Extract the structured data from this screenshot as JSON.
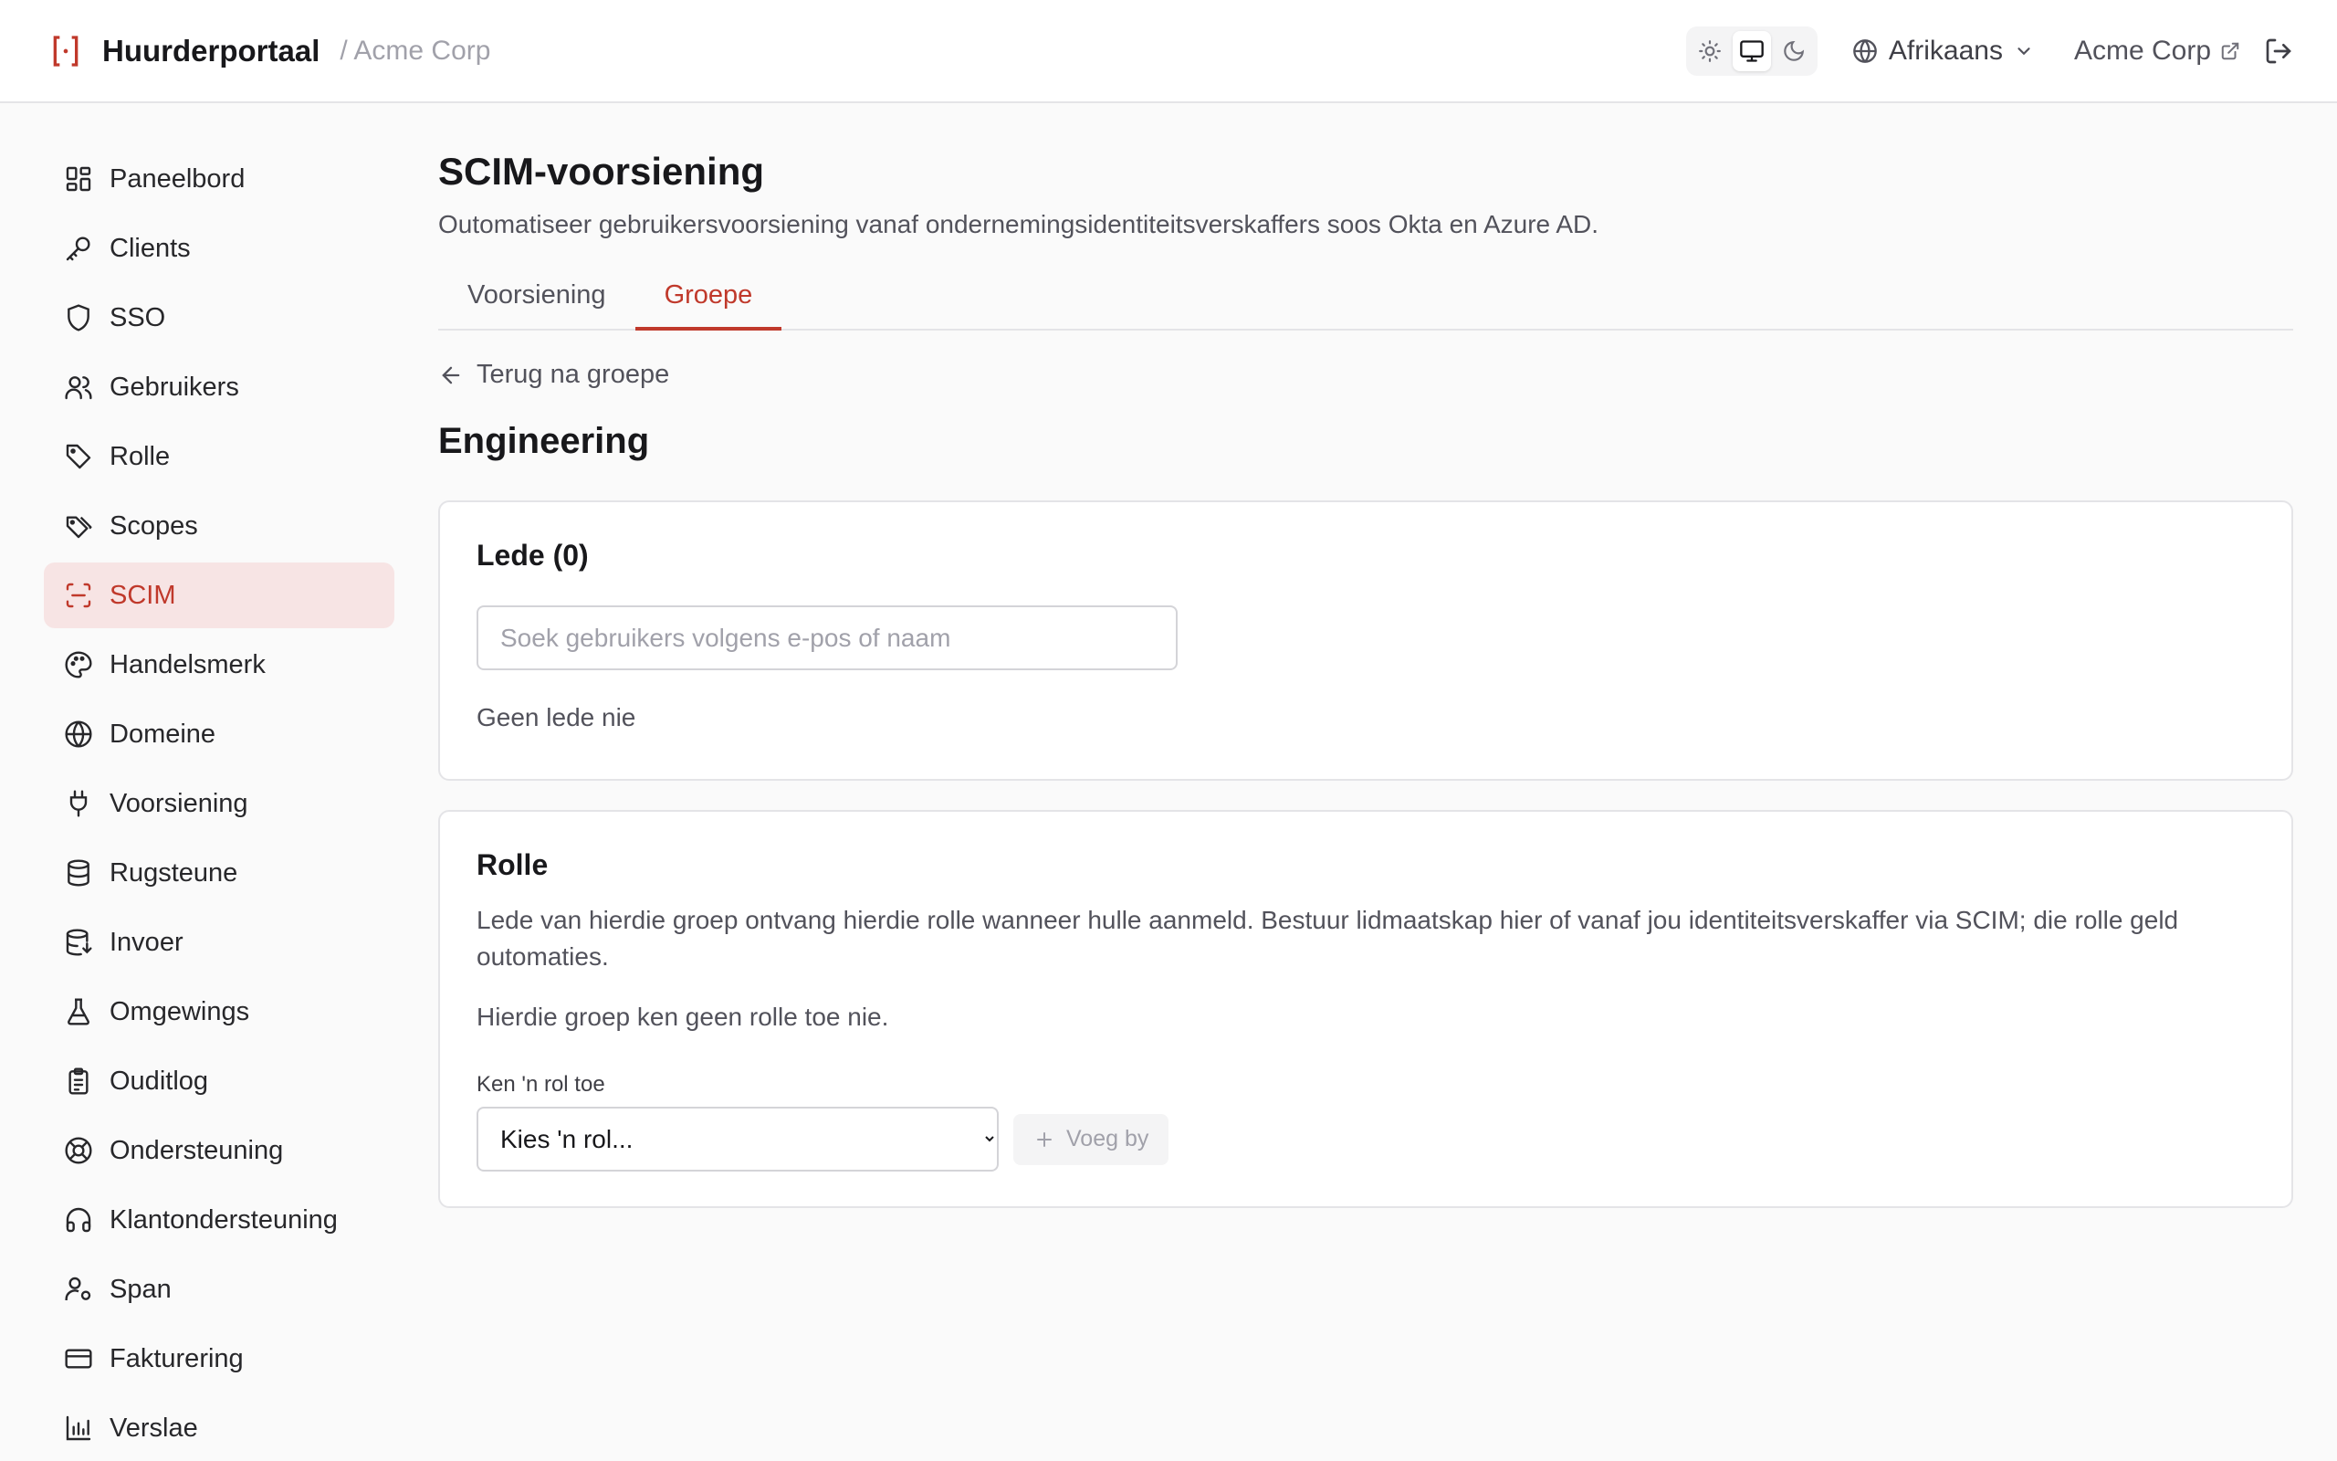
{
  "header": {
    "title": "Huurderportaal",
    "tenant_crumb": "/ Acme Corp",
    "language": "Afrikaans",
    "tenant_link": "Acme Corp",
    "theme_active": "system"
  },
  "sidebar": {
    "items": [
      {
        "label": "Paneelbord",
        "icon": "dashboard-icon"
      },
      {
        "label": "Clients",
        "icon": "key-icon"
      },
      {
        "label": "SSO",
        "icon": "shield-icon"
      },
      {
        "label": "Gebruikers",
        "icon": "users-icon"
      },
      {
        "label": "Rolle",
        "icon": "tag-icon"
      },
      {
        "label": "Scopes",
        "icon": "tags-icon"
      },
      {
        "label": "SCIM",
        "icon": "scan-icon",
        "active": true
      },
      {
        "label": "Handelsmerk",
        "icon": "palette-icon"
      },
      {
        "label": "Domeine",
        "icon": "globe-icon"
      },
      {
        "label": "Voorsiening",
        "icon": "plug-icon"
      },
      {
        "label": "Rugsteune",
        "icon": "database-icon"
      },
      {
        "label": "Invoer",
        "icon": "database-import-icon"
      },
      {
        "label": "Omgewings",
        "icon": "flask-icon"
      },
      {
        "label": "Ouditlog",
        "icon": "clipboard-icon"
      },
      {
        "label": "Ondersteuning",
        "icon": "lifebuoy-icon"
      },
      {
        "label": "Klantondersteuning",
        "icon": "headphones-icon"
      },
      {
        "label": "Span",
        "icon": "user-cog-icon"
      },
      {
        "label": "Fakturering",
        "icon": "credit-card-icon"
      },
      {
        "label": "Verslae",
        "icon": "bar-chart-icon"
      }
    ]
  },
  "main": {
    "title": "SCIM-voorsiening",
    "description": "Outomatiseer gebruikersvoorsiening vanaf ondernemingsidentiteitsverskaffers soos Okta en Azure AD.",
    "tabs": [
      {
        "label": "Voorsiening",
        "active": false
      },
      {
        "label": "Groepe",
        "active": true
      }
    ],
    "back_link": "Terug na groepe",
    "group_name": "Engineering",
    "members": {
      "title": "Lede (0)",
      "search_placeholder": "Soek gebruikers volgens e-pos of naam",
      "empty": "Geen lede nie"
    },
    "roles": {
      "title": "Rolle",
      "description": "Lede van hierdie groep ontvang hierdie rolle wanneer hulle aanmeld. Bestuur lidmaatskap hier of vanaf jou identiteitsverskaffer via SCIM; die rolle geld outomaties.",
      "empty": "Hierdie groep ken geen rolle toe nie.",
      "assign_label": "Ken 'n rol toe",
      "select_value": "Kies 'n rol...",
      "add_label": "Voeg by"
    }
  },
  "colors": {
    "accent": "#c0392b",
    "active_bg": "#f7e4e4"
  }
}
